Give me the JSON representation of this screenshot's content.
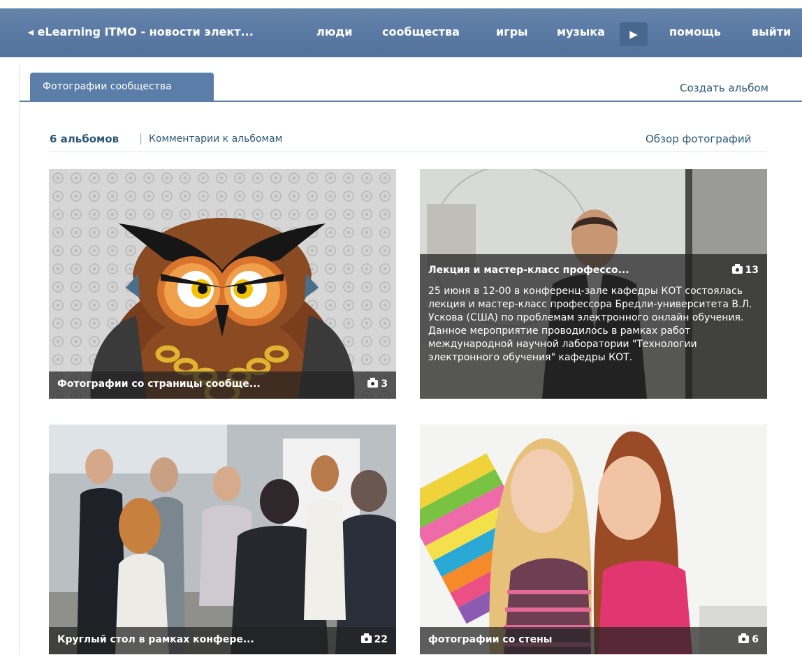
{
  "nav": {
    "back_label": "◂ eLearning ITMO - новости элект...",
    "items": [
      "люди",
      "сообщества",
      "игры",
      "музыка",
      "помощь",
      "выйти"
    ],
    "more_icon": "play-right-icon"
  },
  "tabs": {
    "active": "Фотографии сообщества",
    "create_album": "Создать альбом"
  },
  "subheader": {
    "album_count": "6 альбомов",
    "separator": "|",
    "comments_link": "Комментарии к альбомам",
    "overview_link": "Обзор фотографий"
  },
  "albums": [
    {
      "title": "Фотографии со страницы сообще...",
      "count": "3"
    },
    {
      "title": "Лекция и мастер-класс профессо...",
      "count": "13",
      "description": "25 июня в 12-00 в конференц-зале кафедры КОТ состоялась лекция и мастер-класс профессора Бредли-университета В.Л. Ускова (США) по проблемам электронного онлайн обучения. Данное мероприятие проводилось в рамках работ международной научной лаборатории \"Технологии электронного обучения\" кафедры КОТ."
    },
    {
      "title": "Круглый стол в рамках конфере...",
      "count": "22"
    },
    {
      "title": "фотографии со стены",
      "count": "6"
    }
  ],
  "colors": {
    "nav": "#5a7aa3",
    "link": "#2b587a",
    "tab": "#5b7ea8"
  }
}
